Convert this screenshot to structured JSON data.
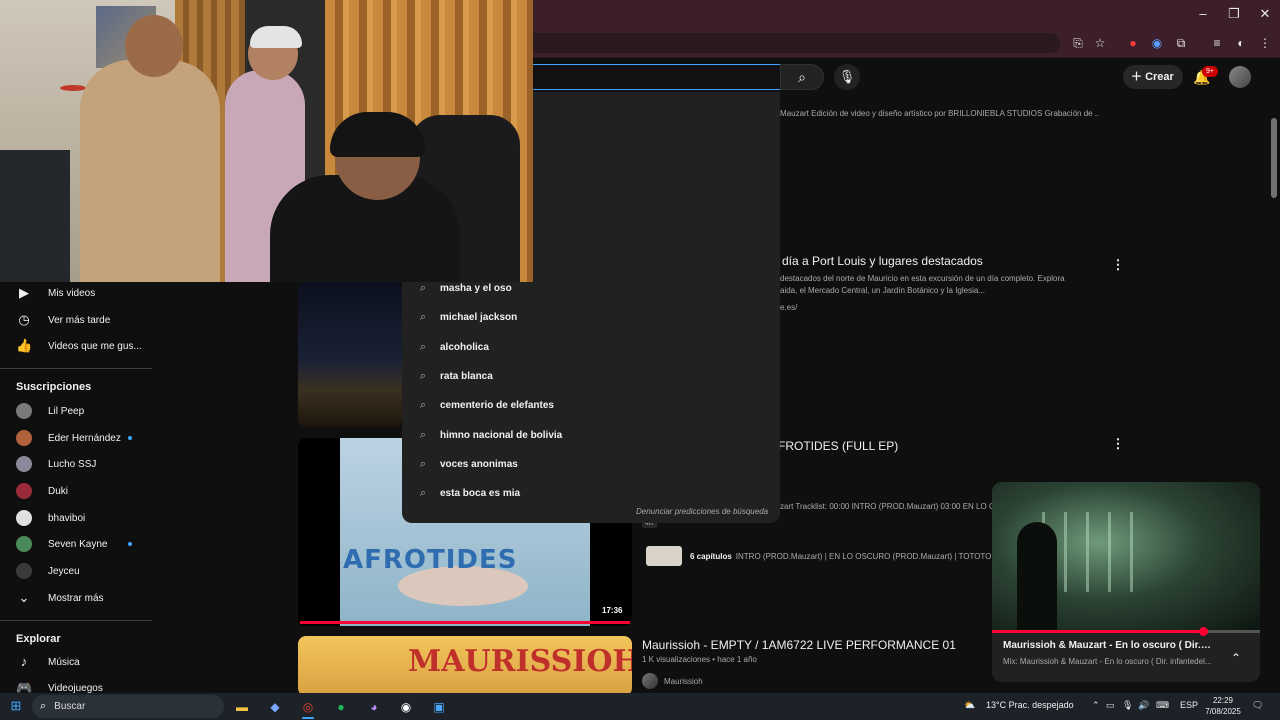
{
  "header": {
    "create_label": "Crear",
    "notifications_badge": "9+"
  },
  "sidebar": {
    "you_items": [
      {
        "label": "Mis videos",
        "icon": "video-icon"
      },
      {
        "label": "Ver más tarde",
        "icon": "clock-icon"
      },
      {
        "label": "Videos que me gus...",
        "icon": "thumbs-up-icon"
      }
    ],
    "subscriptions_title": "Suscripciones",
    "subscriptions": [
      {
        "label": "Lil Peep",
        "new": false,
        "color": "#7a7a7a"
      },
      {
        "label": "Eder Hernández",
        "new": true,
        "color": "#b0623a"
      },
      {
        "label": "Lucho SSJ",
        "new": false,
        "color": "#8a8a9a"
      },
      {
        "label": "Duki",
        "new": false,
        "color": "#9a2a3a"
      },
      {
        "label": "bhaviboi",
        "new": false,
        "color": "#e0e0e0"
      },
      {
        "label": "Seven Kayne",
        "new": true,
        "color": "#4a8a5a"
      },
      {
        "label": "Jeyceu",
        "new": false,
        "color": "#3a3a3a"
      }
    ],
    "show_more_label": "Mostrar más",
    "explore_title": "Explorar",
    "explore_items": [
      {
        "label": "Música",
        "icon": "music-icon"
      },
      {
        "label": "Videojuegos",
        "icon": "gamepad-icon"
      }
    ]
  },
  "search": {
    "suggestions": [
      "masha y el oso",
      "michael jackson",
      "alcoholica",
      "rata blanca",
      "cementerio de elefantes",
      "himno nacional de bolivia",
      "voces anonimas",
      "esta boca es mia"
    ],
    "report_label": "Denunciar predicciones de búsqueda"
  },
  "results": {
    "top_desc": "Mauzart Edición de video y diseño artístico por BRILLONIEBLA STUDIOS Grabación de ...",
    "video1": {
      "title": "día a Port Louis y lugares destacados",
      "desc1": "destacados del norte de Mauricio en esta excursión de un día completo. Explora",
      "desc2": "aida, el Mercado Central, un Jardín Botánico y la Iglesia...",
      "link": "e.es/"
    },
    "video2": {
      "title": "FROTIDES (FULL EP)",
      "thumb_text": "AFROTIDES",
      "duration": "17:36",
      "desc": "zart Tracklist: 00:00 INTRO (PROD.Mauzart) 03:00 EN LO OS",
      "badge": "4K",
      "chapters_count": "6 capítulos",
      "chapters_desc": "INTRO (PROD.Mauzart) | EN LO OSCURO (PROD.Mauzart) | TOTOTO con M"
    },
    "video3": {
      "title": "Maurissioh - EMPTY / 1AM6722 LIVE PERFORMANCE 01",
      "thumb_text": "MAURISSIOH",
      "meta": "1 K visualizaciones • hace 1 año",
      "channel": "Maurissioh"
    }
  },
  "miniplayer": {
    "title": "Maurissioh & Mauzart - En lo oscuro ( Dir. infant...",
    "subtitle": "Mix: Maurissioh & Mauzart - En lo oscuro ( Dir. infantedel...",
    "progress": 0.79
  },
  "taskbar": {
    "search_label": "Buscar",
    "weather": "13°C  Prac. despejado",
    "lang": "ESP",
    "time": "22:29",
    "date": "7/08/2025"
  }
}
